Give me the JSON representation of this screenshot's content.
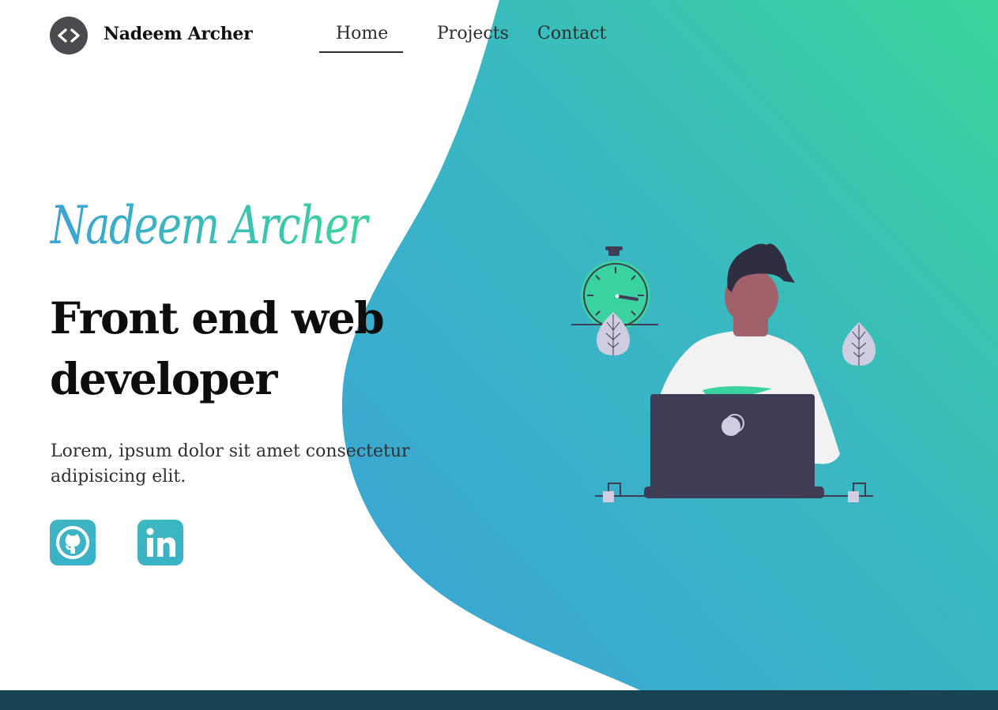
{
  "header": {
    "brand_name": "Nadeem Archer",
    "logo_icon": "code-brackets-icon",
    "nav": [
      {
        "label": "Home",
        "active": true
      },
      {
        "label": "Projects",
        "active": false
      },
      {
        "label": "Contact",
        "active": false
      }
    ]
  },
  "hero": {
    "script_name": "Nadeem Archer",
    "role": "Front end web developer",
    "blurb": "Lorem, ipsum dolor sit amet consectetur adipisicing elit.",
    "social": [
      {
        "icon": "github-icon"
      },
      {
        "icon": "linkedin-icon"
      }
    ]
  },
  "colors": {
    "gradient_start": "#3ba2d6",
    "gradient_end": "#3bd49a",
    "footer": "#174352",
    "text_dark": "#111111"
  }
}
